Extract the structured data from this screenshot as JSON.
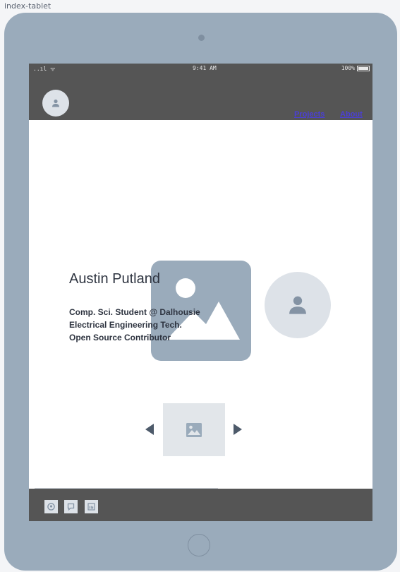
{
  "frame": {
    "label": "index-tablet"
  },
  "status_bar": {
    "signal": "..ıl ᯤ",
    "time": "9:41 AM",
    "battery": "100%"
  },
  "header": {
    "nav": [
      {
        "label": "Projects"
      },
      {
        "label": "About"
      }
    ]
  },
  "hero": {
    "name": "Austin Putland",
    "bio": [
      "Comp. Sci. Student @ Dalhousie",
      "Electrical Engineering Tech.",
      "Open Source Contributor"
    ]
  },
  "icons": {
    "header_avatar": "user-icon",
    "hero_image": "image-placeholder-icon",
    "profile_avatar": "user-icon",
    "carousel_prev": "triangle-left-icon",
    "carousel_next": "triangle-right-icon",
    "carousel_slide": "image-icon",
    "footer_social": [
      "github-icon",
      "chat-icon",
      "linkedin-icon"
    ]
  },
  "colors": {
    "device": "#9aabbb",
    "bar": "#555555",
    "link": "#4b3fd6",
    "placeholder": "#dde2e8"
  }
}
